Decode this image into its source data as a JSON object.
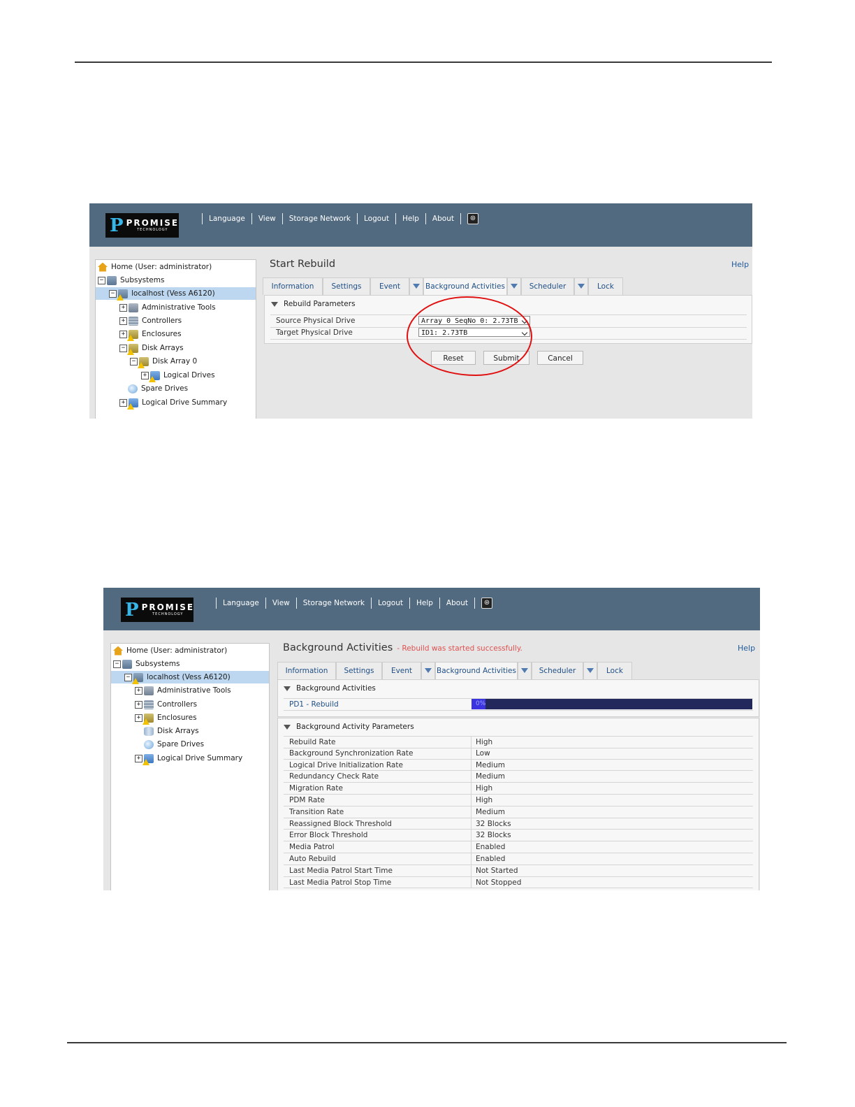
{
  "shot1": {
    "logo": {
      "word": "PROMISE",
      "sub": "TECHNOLOGY"
    },
    "nav": [
      "Language",
      "View",
      "Storage Network",
      "Logout",
      "Help",
      "About"
    ],
    "tree": [
      {
        "label": "Home (User: administrator)",
        "icon": "home-icon"
      },
      {
        "label": "Subsystems",
        "icon": "server-icon"
      },
      {
        "label": "localhost (Vess A6120)",
        "icon": "server-warning-icon"
      },
      {
        "label": "Administrative Tools",
        "icon": "tools-icon"
      },
      {
        "label": "Controllers",
        "icon": "controller-icon"
      },
      {
        "label": "Enclosures",
        "icon": "enclosure-warning-icon"
      },
      {
        "label": "Disk Arrays",
        "icon": "disk-array-warning-icon"
      },
      {
        "label": "Disk Array 0",
        "icon": "disk-array-warning-icon"
      },
      {
        "label": "Logical Drives",
        "icon": "logical-drive-warning-icon"
      },
      {
        "label": "Spare Drives",
        "icon": "spare-drive-icon"
      },
      {
        "label": "Logical Drive Summary",
        "icon": "logical-drive-warning-icon"
      }
    ],
    "title": "Start Rebuild",
    "help": "Help",
    "tabs": [
      "Information",
      "Settings",
      "Event",
      "Background Activities",
      "Scheduler",
      "Lock"
    ],
    "section": "Rebuild Parameters",
    "rows": [
      {
        "label": "Source Physical Drive",
        "value": "Array 0 SeqNo 0: 2.73TB"
      },
      {
        "label": "Target Physical Drive",
        "value": "ID1: 2.73TB"
      }
    ],
    "buttons": {
      "reset": "Reset",
      "submit": "Submit",
      "cancel": "Cancel"
    }
  },
  "shot2": {
    "logo": {
      "word": "PROMISE",
      "sub": "TECHNOLOGY"
    },
    "nav": [
      "Language",
      "View",
      "Storage Network",
      "Logout",
      "Help",
      "About"
    ],
    "tree": [
      {
        "label": "Home (User: administrator)",
        "icon": "home-icon"
      },
      {
        "label": "Subsystems",
        "icon": "server-icon"
      },
      {
        "label": "localhost (Vess A6120)",
        "icon": "server-warning-icon"
      },
      {
        "label": "Administrative Tools",
        "icon": "tools-icon"
      },
      {
        "label": "Controllers",
        "icon": "controller-icon"
      },
      {
        "label": "Enclosures",
        "icon": "enclosure-warning-icon"
      },
      {
        "label": "Disk Arrays",
        "icon": "disk-array-icon"
      },
      {
        "label": "Spare Drives",
        "icon": "spare-drive-icon"
      },
      {
        "label": "Logical Drive Summary",
        "icon": "logical-drive-warning-icon"
      }
    ],
    "title": "Background Activities",
    "status": "- Rebuild was started successfully.",
    "help": "Help",
    "tabs": [
      "Information",
      "Settings",
      "Event",
      "Background Activities",
      "Scheduler",
      "Lock"
    ],
    "activities_section": "Background Activities",
    "activity": {
      "label": "PD1 - Rebuild",
      "progress_text": "0%",
      "progress_fraction": 0.0
    },
    "params_section": "Background Activity Parameters",
    "params": [
      {
        "label": "Rebuild Rate",
        "value": "High"
      },
      {
        "label": "Background Synchronization Rate",
        "value": "Low"
      },
      {
        "label": "Logical Drive Initialization Rate",
        "value": "Medium"
      },
      {
        "label": "Redundancy Check Rate",
        "value": "Medium"
      },
      {
        "label": "Migration Rate",
        "value": "High"
      },
      {
        "label": "PDM Rate",
        "value": "High"
      },
      {
        "label": "Transition Rate",
        "value": "Medium"
      },
      {
        "label": "Reassigned Block Threshold",
        "value": "32 Blocks"
      },
      {
        "label": "Error Block Threshold",
        "value": "32 Blocks"
      },
      {
        "label": "Media Patrol",
        "value": "Enabled"
      },
      {
        "label": "Auto Rebuild",
        "value": "Enabled"
      },
      {
        "label": "Last Media Patrol Start Time",
        "value": "Not Started"
      },
      {
        "label": "Last Media Patrol Stop Time",
        "value": "Not Stopped"
      }
    ]
  },
  "colors": {
    "header": "#526a80",
    "highlight_circle": "#e01010",
    "progress_bar": "#22275c",
    "status_text": "#e05050"
  }
}
